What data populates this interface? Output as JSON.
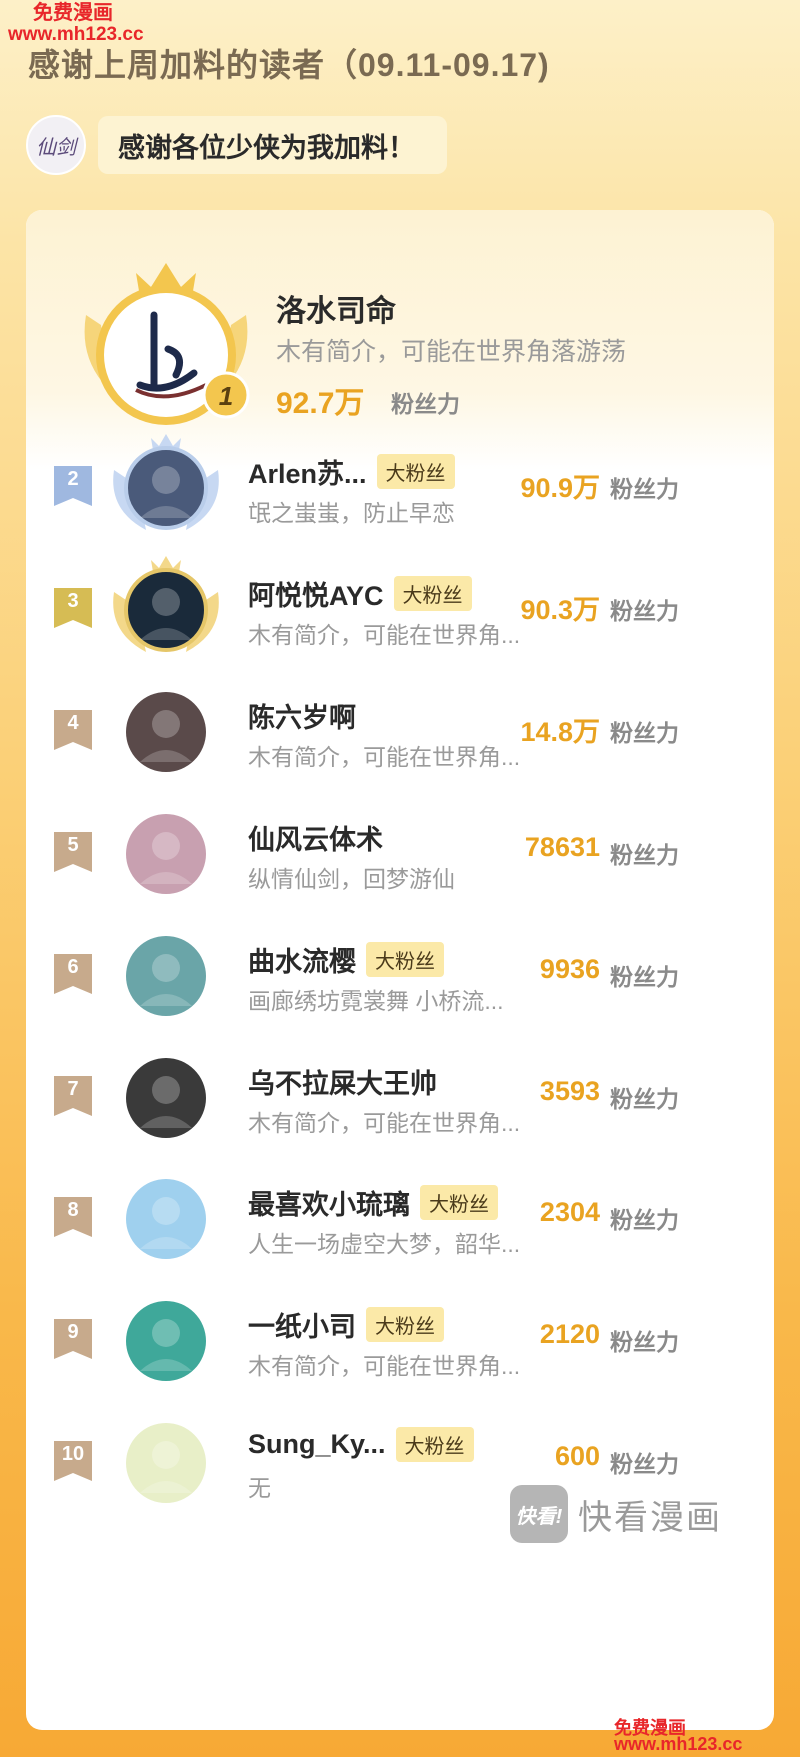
{
  "watermark_top": {
    "line1": "免费漫画",
    "line2": "www.mh123.cc"
  },
  "page_title": "感谢上周加料的读者（09.11-09.17)",
  "intro": {
    "logo_text": "仙剑",
    "message": "感谢各位少侠为我加料！"
  },
  "top_reader": {
    "rank": "1",
    "name": "洛水司命",
    "bio": "木有简介，可能在世界角落游荡",
    "score": "92.7万",
    "score_label": "粉丝力"
  },
  "readers": [
    {
      "rank": "2",
      "name": "Arlen苏...",
      "badge": "大粉丝",
      "bio": "氓之蚩蚩，防止早恋",
      "score": "90.9万",
      "score_label": "粉丝力",
      "avatar_color": "#4a5a7a"
    },
    {
      "rank": "3",
      "name": "阿悦悦AYC",
      "badge": "大粉丝",
      "bio": "木有简介，可能在世界角...",
      "score": "90.3万",
      "score_label": "粉丝力",
      "avatar_color": "#1a2a3a"
    },
    {
      "rank": "4",
      "name": "陈六岁啊",
      "badge": "",
      "bio": "木有简介，可能在世界角...",
      "score": "14.8万",
      "score_label": "粉丝力",
      "avatar_color": "#5a4a4a"
    },
    {
      "rank": "5",
      "name": "仙风云体术",
      "badge": "",
      "bio": "纵情仙剑，回梦游仙",
      "score": "78631",
      "score_label": "粉丝力",
      "avatar_color": "#c8a0b0"
    },
    {
      "rank": "6",
      "name": "曲水流樱",
      "badge": "大粉丝",
      "bio": "画廊绣坊霓裳舞 小桥流...",
      "score": "9936",
      "score_label": "粉丝力",
      "avatar_color": "#6aa5a8"
    },
    {
      "rank": "7",
      "name": "乌不拉屎大王帅",
      "badge": "",
      "bio": "木有简介，可能在世界角...",
      "score": "3593",
      "score_label": "粉丝力",
      "avatar_color": "#3a3a3a"
    },
    {
      "rank": "8",
      "name": "最喜欢小琉璃",
      "badge": "大粉丝",
      "bio": "人生一场虚空大梦，韶华...",
      "score": "2304",
      "score_label": "粉丝力",
      "avatar_color": "#9fd0ee"
    },
    {
      "rank": "9",
      "name": "一纸小司",
      "badge": "大粉丝",
      "bio": "木有简介，可能在世界角...",
      "score": "2120",
      "score_label": "粉丝力",
      "avatar_color": "#3fa89a"
    },
    {
      "rank": "10",
      "name": "Sung_Ky...",
      "badge": "大粉丝",
      "bio": "无",
      "score": "600",
      "score_label": "粉丝力",
      "avatar_color": "#e8efc8"
    }
  ],
  "brand": {
    "icon_text": "快看!",
    "name": "快看漫画"
  },
  "watermark_bottom": {
    "line1": "免费漫画",
    "line2": "www.mh123.cc"
  },
  "colors": {
    "accent": "#e9a321",
    "rank2": "#9fb8e0",
    "rank3": "#d6bc54",
    "rank_other": "#c7aa8c"
  }
}
